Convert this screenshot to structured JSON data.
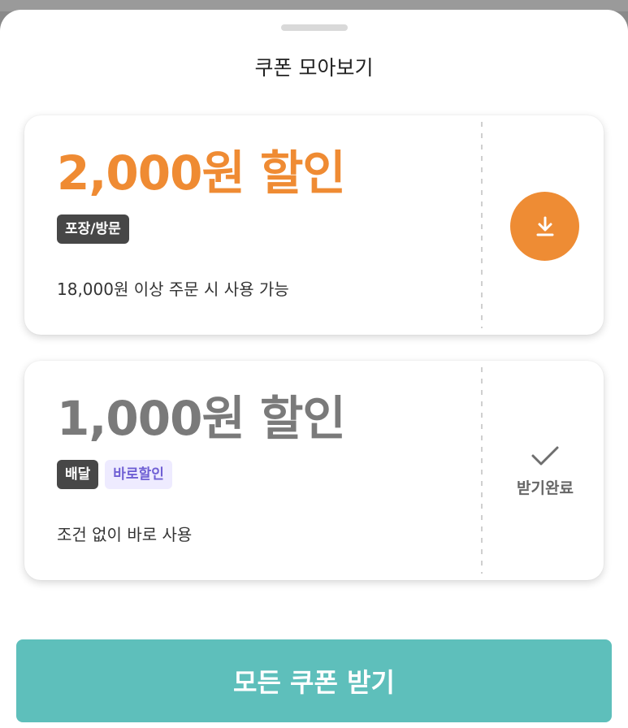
{
  "sheet": {
    "title": "쿠폰 모아보기"
  },
  "coupons": [
    {
      "amount": "2,000원 할인",
      "tags": [
        "포장/방문"
      ],
      "condition": "18,000원 이상 주문 시 사용 가능",
      "state": "download",
      "accent": "#EF8B33"
    },
    {
      "amount": "1,000원 할인",
      "tags": [
        "배달",
        "바로할인"
      ],
      "condition": "조건 없이 바로 사용",
      "state": "received",
      "received_label": "받기완료"
    }
  ],
  "cta": {
    "label": "모든 쿠폰 받기",
    "color": "#5EBFBB"
  },
  "icons": {
    "download": "download-icon",
    "received": "check-icon"
  }
}
